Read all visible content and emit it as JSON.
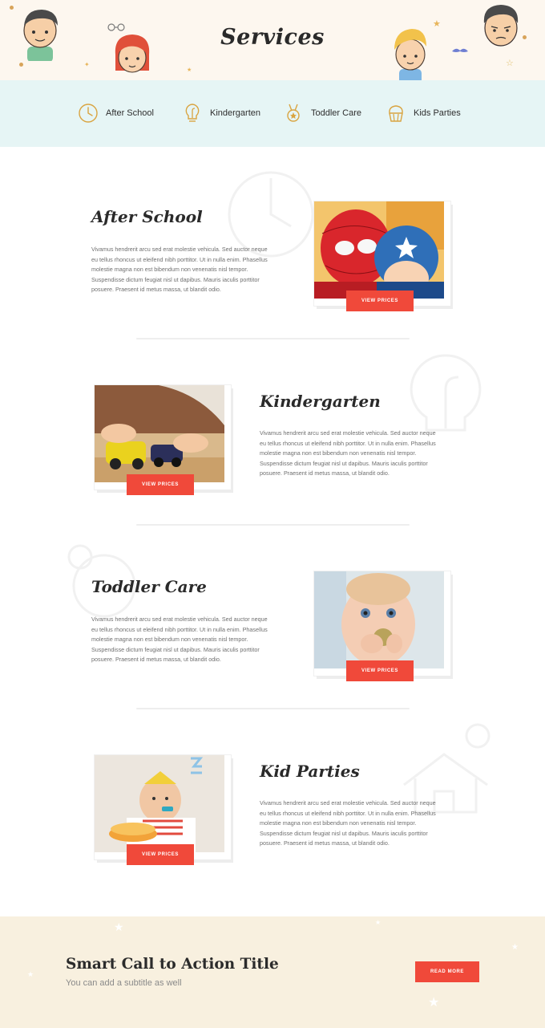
{
  "header": {
    "title": "Services"
  },
  "service_nav": [
    {
      "label": "After School",
      "icon": "clock-icon"
    },
    {
      "label": "Kindergarten",
      "icon": "lightbulb-icon"
    },
    {
      "label": "Toddler Care",
      "icon": "medal-icon"
    },
    {
      "label": "Kids Parties",
      "icon": "cupcake-icon"
    }
  ],
  "services": [
    {
      "title": "After School",
      "description": "Vivamus hendrerit arcu sed erat molestie vehicula. Sed auctor neque eu tellus rhoncus ut eleifend nibh porttitor. Ut in nulla enim. Phasellus molestie magna non est bibendum non venenatis nisl tempor. Suspendisse dictum feugiat nisl ut dapibus. Mauris iaculis porttitor posuere. Praesent id metus massa, ut blandit odio.",
      "button": "VIEW PRICES",
      "photo": "kids-in-superhero-masks-photo"
    },
    {
      "title": "Kindergarten",
      "description": "Vivamus hendrerit arcu sed erat molestie vehicula. Sed auctor neque eu tellus rhoncus ut eleifend nibh porttitor. Ut in nulla enim. Phasellus molestie magna non est bibendum non venenatis nisl tempor. Suspendisse dictum feugiat nisl ut dapibus. Mauris iaculis porttitor posuere. Praesent id metus massa, ut blandit odio.",
      "button": "VIEW PRICES",
      "photo": "child-playing-toy-cars-photo"
    },
    {
      "title": "Toddler Care",
      "description": "Vivamus hendrerit arcu sed erat molestie vehicula. Sed auctor neque eu tellus rhoncus ut eleifend nibh porttitor. Ut in nulla enim. Phasellus molestie magna non est bibendum non venenatis nisl tempor. Suspendisse dictum feugiat nisl ut dapibus. Mauris iaculis porttitor posuere. Praesent id metus massa, ut blandit odio.",
      "button": "VIEW PRICES",
      "photo": "baby-eating-photo"
    },
    {
      "title": "Kid Parties",
      "description": "Vivamus hendrerit arcu sed erat molestie vehicula. Sed auctor neque eu tellus rhoncus ut eleifend nibh porttitor. Ut in nulla enim. Phasellus molestie magna non est bibendum non venenatis nisl tempor. Suspendisse dictum feugiat nisl ut dapibus. Mauris iaculis porttitor posuere. Praesent id metus massa, ut blandit odio.",
      "button": "VIEW PRICES",
      "photo": "toddler-birthday-party-photo"
    }
  ],
  "cta": {
    "title": "Smart Call to Action Title",
    "subtitle": "You can add a subtitle as well",
    "button": "READ MORE"
  },
  "colors": {
    "accent_red": "#f0493a",
    "header_bg": "#fdf7ef",
    "nav_bg": "#e6f5f5",
    "icon_gold": "#d9a441",
    "cta_bg": "#f8f0df"
  }
}
